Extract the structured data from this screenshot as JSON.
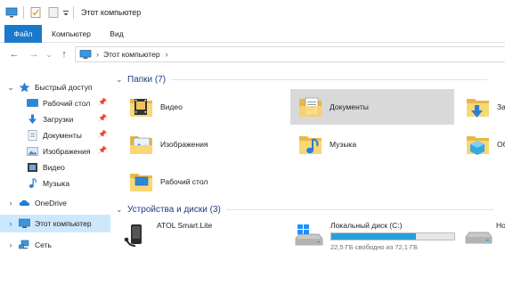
{
  "window": {
    "title": "Этот компьютер"
  },
  "ribbon": {
    "tabs": [
      "Файл",
      "Компьютер",
      "Вид"
    ]
  },
  "navbar": {
    "back_glyph": "←",
    "forward_glyph": "→",
    "dropdown_glyph": "⌄",
    "up_glyph": "↑",
    "breadcrumb": [
      "Этот компьютер"
    ],
    "separator": "›"
  },
  "navpane": {
    "quick_access": "Быстрый доступ",
    "quick_items": [
      {
        "label": "Рабочий стол",
        "icon": "desktop-icon",
        "pinned": true
      },
      {
        "label": "Загрузки",
        "icon": "downloads-icon",
        "pinned": true
      },
      {
        "label": "Документы",
        "icon": "documents-icon",
        "pinned": true
      },
      {
        "label": "Изображения",
        "icon": "pictures-icon",
        "pinned": true
      },
      {
        "label": "Видео",
        "icon": "video-icon",
        "pinned": false
      },
      {
        "label": "Музыка",
        "icon": "music-icon",
        "pinned": false
      }
    ],
    "onedrive": "OneDrive",
    "this_pc": "Этот компьютер",
    "network": "Сеть",
    "pin_glyph": "📌"
  },
  "content": {
    "folders_header": "Папки (7)",
    "folders": [
      {
        "label": "Видео",
        "icon": "video-folder-icon"
      },
      {
        "label": "Документы",
        "icon": "documents-folder-icon",
        "selected": true
      },
      {
        "label": "За",
        "icon": "downloads-folder-icon"
      },
      {
        "label": "Изображения",
        "icon": "pictures-folder-icon"
      },
      {
        "label": "Музыка",
        "icon": "music-folder-icon"
      },
      {
        "label": "Об",
        "icon": "3d-objects-folder-icon"
      },
      {
        "label": "Рабочий стол",
        "icon": "desktop-folder-icon"
      }
    ],
    "devices_header": "Устройства и диски (3)",
    "devices": [
      {
        "label": "ATOL Smart.Lite",
        "icon": "portable-device-icon"
      },
      {
        "label": "Локальный диск (C:)",
        "icon": "system-drive-icon",
        "free_text": "22,5 ГБ свободно из 72,1 ГБ",
        "used_fraction": 0.69
      },
      {
        "label": "Но",
        "icon": "drive-icon"
      }
    ]
  },
  "colors": {
    "accent": "#1979ca",
    "selection": "#cce8ff",
    "tile_selected": "#d9d9d9",
    "disk_bar": "#26a0da",
    "folder": "#f8d775"
  }
}
